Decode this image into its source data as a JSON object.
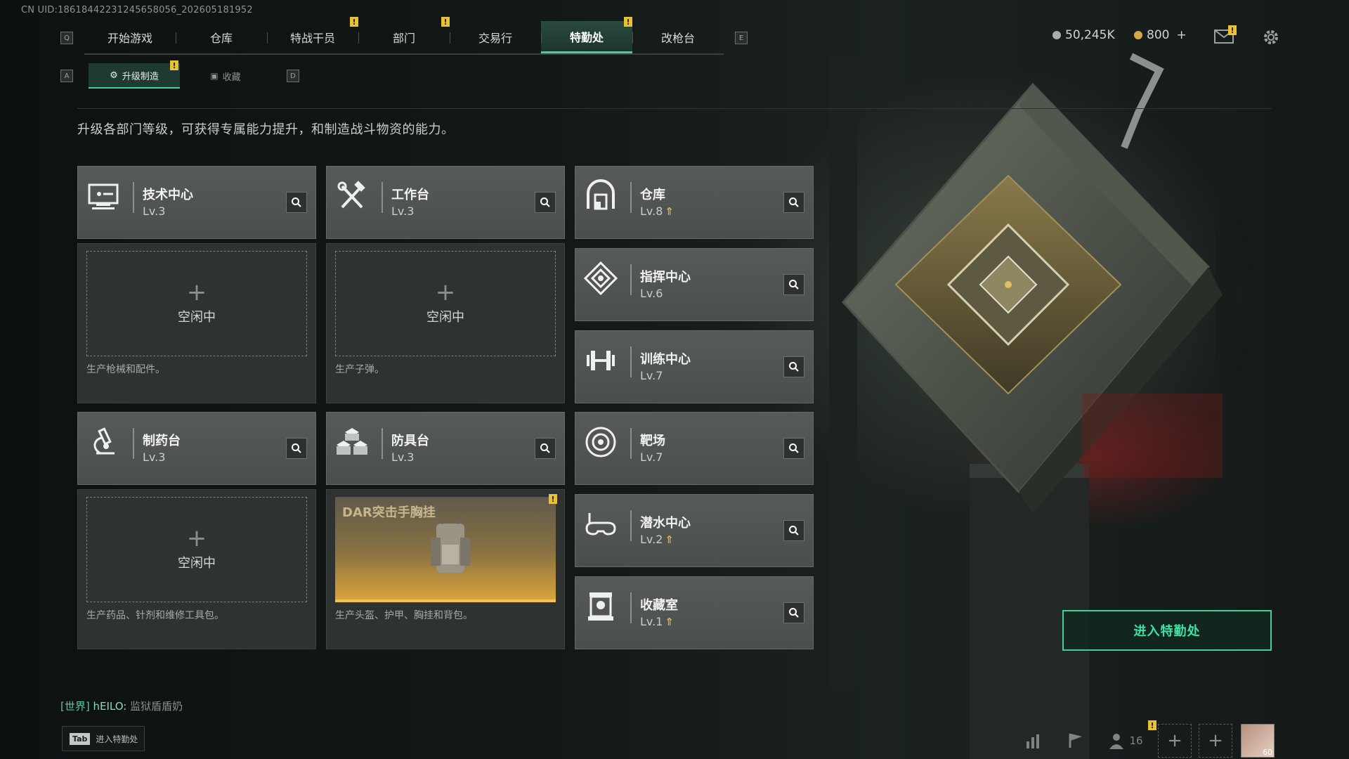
{
  "uid_text": "CN UID:1861844223124565​8056_202605181952",
  "nav": {
    "left_key": "Q",
    "right_key": "E",
    "tabs": [
      {
        "label": "开始游戏",
        "badge": ""
      },
      {
        "label": "仓库",
        "badge": ""
      },
      {
        "label": "特战干员",
        "badge": "!"
      },
      {
        "label": "部门",
        "badge": "!"
      },
      {
        "label": "交易行",
        "badge": ""
      },
      {
        "label": "特勤处",
        "badge": "!",
        "active": true
      },
      {
        "label": "改枪台",
        "badge": ""
      }
    ]
  },
  "resources": {
    "silver": "50,245K",
    "gold": "800",
    "gold_add": "+",
    "mail_badge": "!"
  },
  "subnav": {
    "left_key": "A",
    "right_key": "D",
    "tabs": [
      {
        "label": "升级制造",
        "active": true,
        "badge": "!"
      },
      {
        "label": "收藏",
        "active": false
      }
    ]
  },
  "description": "升级各部门等级，可获得专属能力提升，和制造战斗物资的能力。",
  "departments": {
    "tech_center": {
      "name": "技术中心",
      "level": "Lv.3",
      "icon": "computer-icon",
      "slot_idle": "空闲中",
      "slot_desc": "生产枪械和配件。"
    },
    "workbench": {
      "name": "工作台",
      "level": "Lv.3",
      "icon": "tools-icon",
      "slot_idle": "空闲中",
      "slot_desc": "生产子弹。"
    },
    "pharmacy": {
      "name": "制药台",
      "level": "Lv.3",
      "icon": "microscope-icon",
      "slot_idle": "空闲中",
      "slot_desc": "生产药品、针剂和维修工具包。"
    },
    "armor_bench": {
      "name": "防具台",
      "level": "Lv.3",
      "icon": "armor-blocks-icon",
      "slot_item": "DAR突击手胸挂",
      "slot_badge": "!",
      "slot_desc": "生产头盔、护甲、胸挂和背包。"
    },
    "warehouse": {
      "name": "仓库",
      "level": "Lv.8",
      "upgradable": true,
      "icon": "warehouse-icon"
    },
    "command_center": {
      "name": "指挥中心",
      "level": "Lv.6",
      "icon": "command-icon"
    },
    "training_center": {
      "name": "训练中心",
      "level": "Lv.7",
      "icon": "dumbbell-icon"
    },
    "shooting_range": {
      "name": "靶场",
      "level": "Lv.7",
      "icon": "target-icon"
    },
    "diving_center": {
      "name": "潜水中心",
      "level": "Lv.2",
      "upgradable": true,
      "icon": "diving-mask-icon"
    },
    "collection_room": {
      "name": "收藏室",
      "level": "Lv.1",
      "upgradable": true,
      "icon": "display-case-icon"
    }
  },
  "enter_button": "进入特勤处",
  "chat": {
    "channel": "[世界]",
    "name": "hEILO:",
    "message": "监狱盾盾奶"
  },
  "tab_hint": {
    "key": "Tab",
    "label": "进入特勤处"
  },
  "bottom_bar": {
    "friends_count": "16",
    "avatar_level": "60",
    "friend_badge": "!"
  },
  "colors": {
    "accent": "#3fd39a",
    "badge": "#e8c230",
    "upgrade": "#e0b24a"
  }
}
